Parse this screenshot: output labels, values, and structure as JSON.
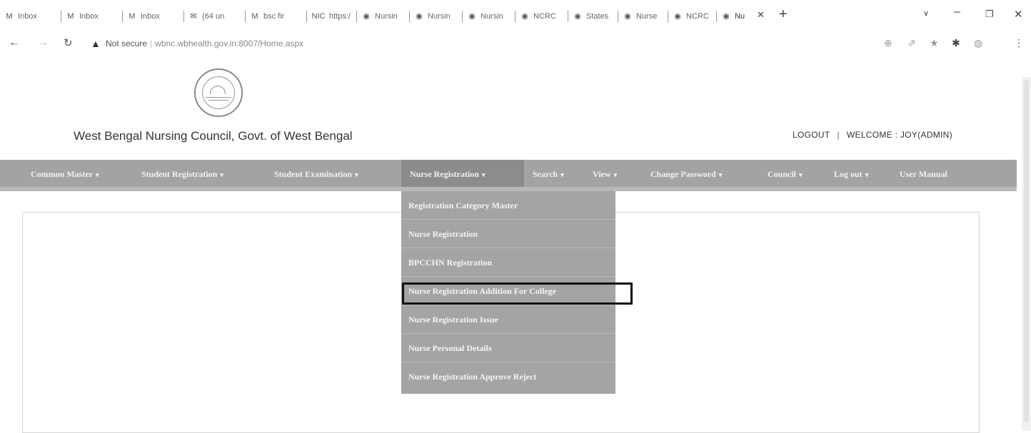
{
  "browser": {
    "tabs": [
      {
        "icon": "M",
        "label": "Inbox"
      },
      {
        "icon": "M",
        "label": "Inbox"
      },
      {
        "icon": "M",
        "label": "Inbox"
      },
      {
        "icon": "✉",
        "label": "(64 un"
      },
      {
        "icon": "M",
        "label": "bsc fir"
      },
      {
        "icon": "NIC",
        "label": "https:/"
      },
      {
        "icon": "◉",
        "label": "Nursin"
      },
      {
        "icon": "◉",
        "label": "Nursin"
      },
      {
        "icon": "◉",
        "label": "Nursin"
      },
      {
        "icon": "◉",
        "label": "NCRC"
      },
      {
        "icon": "◉",
        "label": "States"
      },
      {
        "icon": "◉",
        "label": "Nurse"
      },
      {
        "icon": "◉",
        "label": "NCRC"
      },
      {
        "icon": "◉",
        "label": "Nu"
      }
    ],
    "new_tab": "+",
    "security_label": "Not secure",
    "url": "wbnc.wbhealth.gov.in:8007/Home.aspx"
  },
  "header": {
    "title": "West Bengal Nursing Council, Govt. of West Bengal",
    "logout": "LOGOUT",
    "welcome": "WELCOME : JOY(ADMIN)"
  },
  "menu": {
    "items": [
      "Common Master",
      "Student Registration",
      "Student Examination",
      "Nurse Registration",
      "Search",
      "View",
      "Change Password",
      "Council",
      "Log out",
      "User Manual"
    ],
    "active_index": 3
  },
  "dropdown": {
    "items": [
      "Registration Category Master",
      "Nurse Registration",
      "BPCCHN Registration",
      "Nurse Registration Addition For College",
      "Nurse Registration Issue",
      "Nurse Personal Details",
      "Nurse Registration Approve Reject"
    ],
    "highlighted_index": 3
  },
  "colors": {
    "menubar": "#a3a3a3",
    "menu_active": "#8c8c8c",
    "dropdown": "#a4a4a4",
    "highlight_border": "#111111"
  }
}
